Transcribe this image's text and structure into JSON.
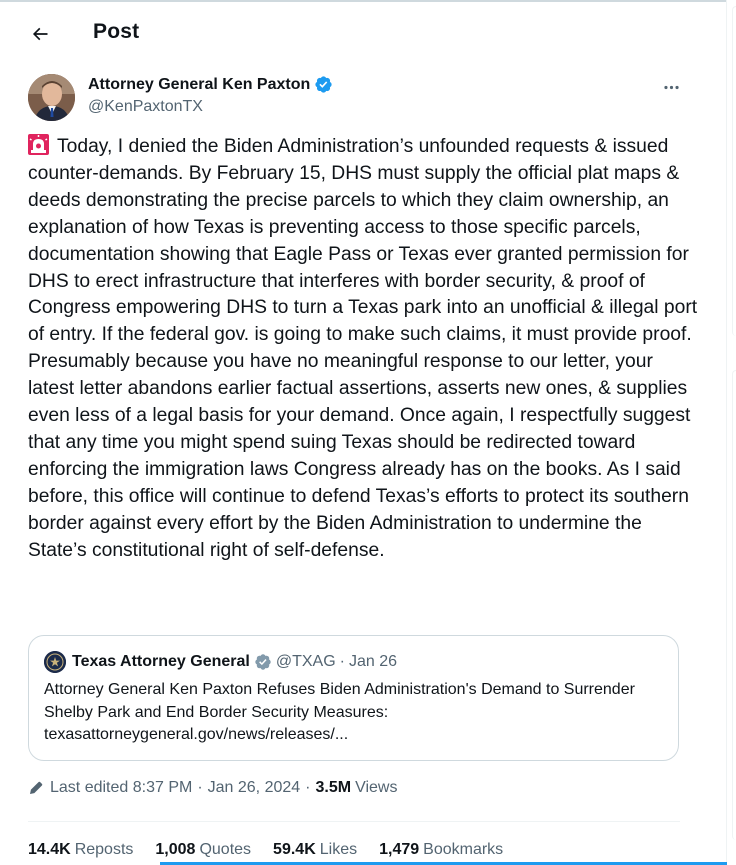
{
  "header": {
    "title": "Post"
  },
  "author": {
    "name": "Attorney General Ken Paxton",
    "handle": "@KenPaxtonTX",
    "verified": true
  },
  "post": {
    "emoji": "siren-icon",
    "text": "Today, I denied the Biden Administration’s unfounded requests & issued counter-demands. By February 15, DHS must supply the official plat maps & deeds demonstrating the precise parcels to which they claim ownership, an explanation of how Texas is preventing access to those specific parcels, documentation showing that Eagle Pass or Texas ever granted permission for DHS to erect infrastructure that interferes with border security, & proof of Congress empowering DHS to turn a Texas park into an unofficial & illegal port of entry. If the federal gov. is going to make such claims, it must provide proof. Presumably because you have no meaningful response to our letter, your latest letter abandons earlier factual assertions, asserts new ones, & supplies even less of a legal basis for your demand. Once again, I respectfully suggest that any time you might spend suing Texas should be redirected toward enforcing the immigration laws Congress already has on the books. As I said before, this office will continue to defend Texas’s efforts to protect its southern border against every effort by the Biden Administration to undermine the State’s constitutional right of self-defense."
  },
  "quote": {
    "name": "Texas Attorney General",
    "handle": "@TXAG",
    "dot": "·",
    "date": "Jan 26",
    "text": "Attorney General Ken Paxton Refuses Biden Administration's Demand to Surrender Shelby Park and End Border Security Measures: texasattorneygeneral.gov/news/releases/..."
  },
  "meta": {
    "edited": "Last edited 8:37 PM",
    "sep1": "·",
    "date": "Jan 26, 2024",
    "sep2": "·",
    "views_count": "3.5M",
    "views_label": "Views"
  },
  "stats": [
    {
      "num": "14.4K",
      "label": "Reposts"
    },
    {
      "num": "1,008",
      "label": "Quotes"
    },
    {
      "num": "59.4K",
      "label": "Likes"
    },
    {
      "num": "1,479",
      "label": "Bookmarks"
    }
  ],
  "colors": {
    "accent": "#1d9bf0",
    "text": "#0f1419",
    "secondary": "#536471",
    "border": "#cfd9de",
    "siren": "#e0245e"
  }
}
